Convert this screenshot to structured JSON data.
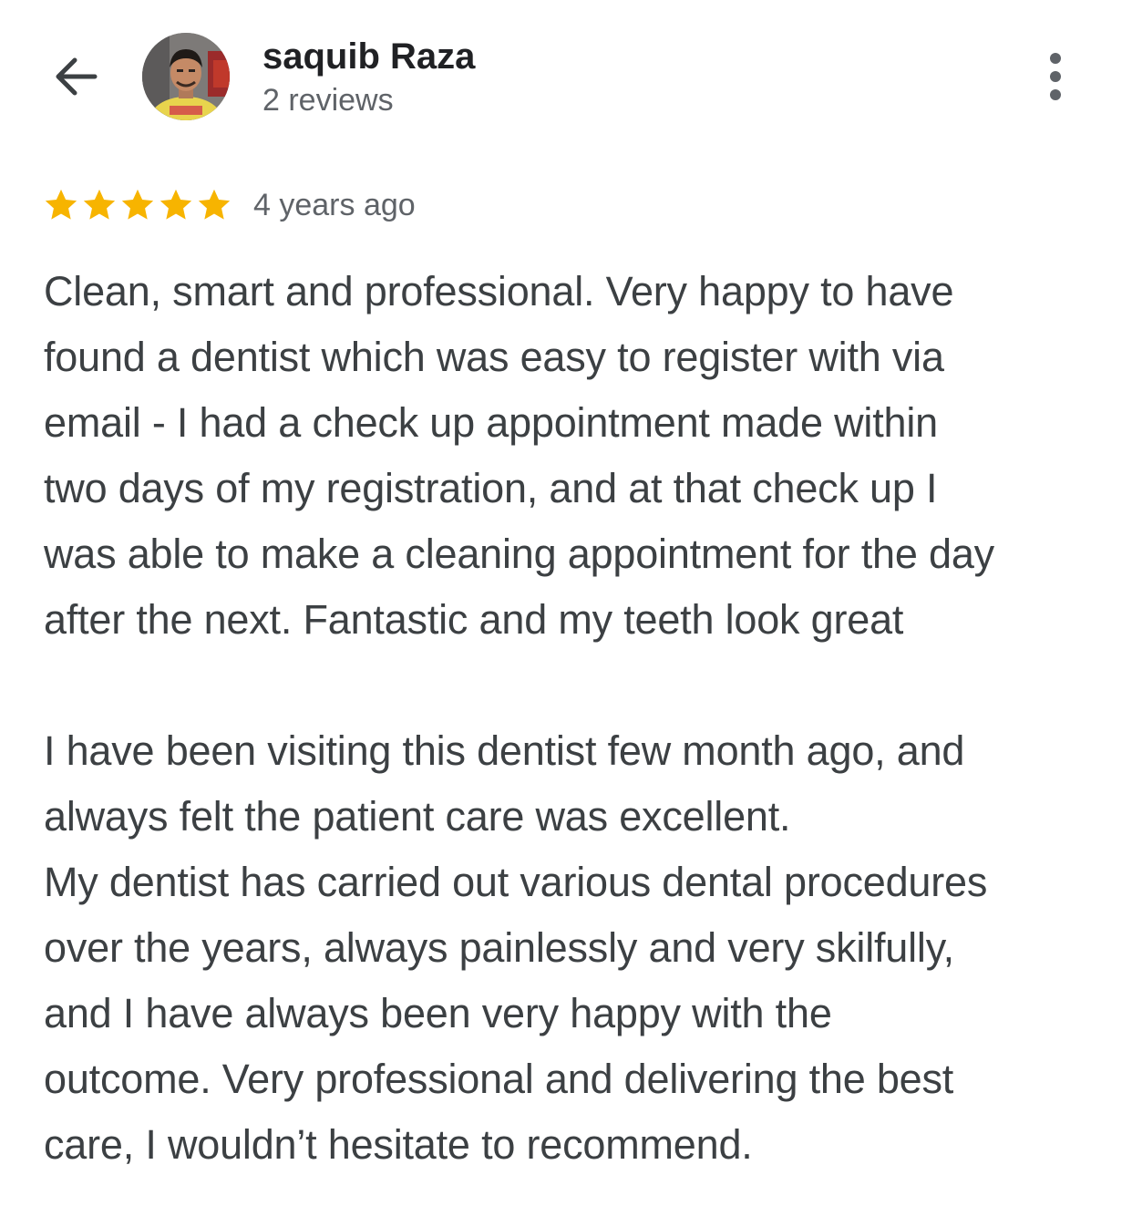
{
  "header": {
    "back_icon": "arrow-left-icon",
    "avatar_icon": "user-avatar",
    "user_name": "saquib Raza",
    "review_count": "2 reviews",
    "more_icon": "more-vert-icon"
  },
  "review": {
    "rating": 5,
    "max_rating": 5,
    "star_color": "#F7B400",
    "time_ago": "4 years ago",
    "text": "Clean, smart and professional. Very happy to have\nfound a dentist which was easy to register with via\nemail - I had a check up appointment made within\ntwo days of my registration, and at that check up I\nwas able to make a cleaning appointment for the day\nafter the next. Fantastic and my teeth look great\n\nI have been visiting this dentist few month ago, and\nalways felt the patient care was excellent.\nMy dentist has carried out various dental procedures\nover the years, always painlessly and very skilfully,\nand I have always been very happy with the\noutcome. Very professional and delivering the best\ncare, I wouldn’t hesitate to recommend."
  }
}
